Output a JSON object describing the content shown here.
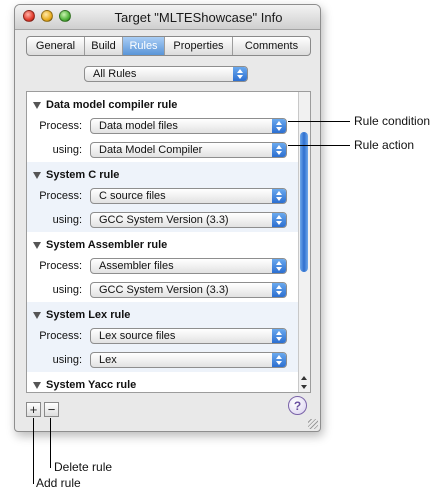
{
  "window": {
    "title": "Target \"MLTEShowcase\" Info"
  },
  "tabs": [
    {
      "label": "General"
    },
    {
      "label": "Build"
    },
    {
      "label": "Rules"
    },
    {
      "label": "Properties"
    },
    {
      "label": "Comments"
    }
  ],
  "filter": {
    "selected": "All Rules"
  },
  "rules": [
    {
      "title": "Data model compiler rule",
      "process_label": "Process:",
      "process": "Data model files",
      "using_label": "using:",
      "using": "Data Model Compiler"
    },
    {
      "title": "System C rule",
      "process_label": "Process:",
      "process": "C source files",
      "using_label": "using:",
      "using": "GCC System Version (3.3)"
    },
    {
      "title": "System Assembler rule",
      "process_label": "Process:",
      "process": "Assembler files",
      "using_label": "using:",
      "using": "GCC System Version (3.3)"
    },
    {
      "title": "System Lex rule",
      "process_label": "Process:",
      "process": "Lex source files",
      "using_label": "using:",
      "using": "Lex"
    },
    {
      "title": "System Yacc rule"
    }
  ],
  "buttons": {
    "add": "+",
    "remove": "−",
    "help": "?"
  },
  "callouts": {
    "rule_condition": "Rule condition",
    "rule_action": "Rule action",
    "delete_rule": "Delete rule",
    "add_rule": "Add rule"
  },
  "colors": {
    "accent": "#3b7fdc",
    "active_tab": "#5a95d8",
    "alt_row": "#eef3fa",
    "window_bg": "#e9e9e9"
  },
  "icons": [
    "close-button-icon",
    "minimize-button-icon",
    "zoom-button-icon",
    "disclosure-triangle-icon",
    "popup-arrows-icon",
    "help-icon",
    "resize-grip-icon"
  ]
}
